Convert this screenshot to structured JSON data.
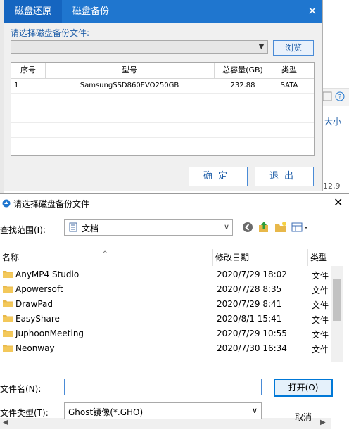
{
  "background": {
    "size_label": "大小",
    "partial_number": "12,9"
  },
  "restore_dialog": {
    "tabs": [
      "磁盘还原",
      "磁盘备份"
    ],
    "select_label": "请选择磁盘备份文件:",
    "select_value": "",
    "browse_label": "浏览",
    "table": {
      "headers": [
        "序号",
        "型号",
        "总容量(GB)",
        "类型"
      ],
      "rows": [
        [
          "1",
          "SamsungSSD860EVO250GB",
          "232.88",
          "SATA"
        ]
      ]
    },
    "ok_label": "确定",
    "exit_label": "退出"
  },
  "file_dialog": {
    "title": "请选择磁盘备份文件",
    "look_in_label": "查找范围(I):",
    "look_in_value": "文档",
    "columns": [
      "名称",
      "修改日期",
      "类型"
    ],
    "rows": [
      {
        "name": "AnyMP4 Studio",
        "date": "2020/7/29 18:02",
        "type": "文件"
      },
      {
        "name": "Apowersoft",
        "date": "2020/7/28 8:35",
        "type": "文件"
      },
      {
        "name": "DrawPad",
        "date": "2020/7/29 8:41",
        "type": "文件"
      },
      {
        "name": "EasyShare",
        "date": "2020/8/1 15:41",
        "type": "文件"
      },
      {
        "name": "JuphoonMeeting",
        "date": "2020/7/29 10:55",
        "type": "文件"
      },
      {
        "name": "Neonway",
        "date": "2020/7/30 16:34",
        "type": "文件"
      }
    ],
    "filename_label": "文件名(N):",
    "filename_value": "",
    "filetype_label": "文件类型(T):",
    "filetype_value": "Ghost镜像(*.GHO)",
    "open_label": "打开(O)",
    "cancel_label": "取消",
    "colors": {
      "accent": "#0078d7",
      "folder": "#e8b84a"
    }
  }
}
